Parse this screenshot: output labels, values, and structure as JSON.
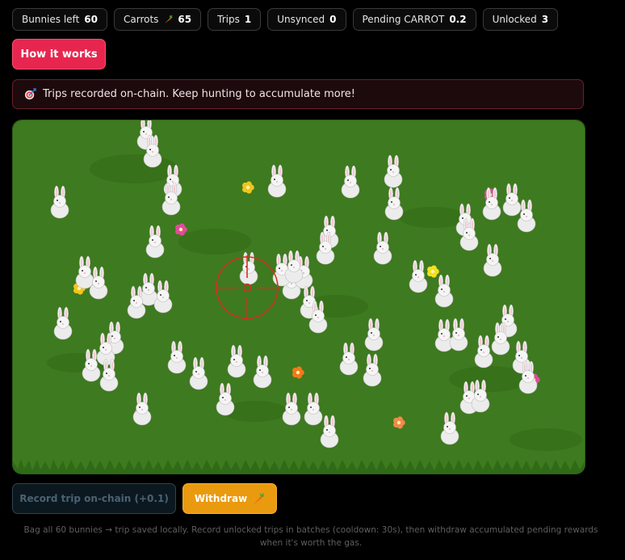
{
  "stats": [
    {
      "label": "Bunnies left",
      "value": "60"
    },
    {
      "label": "Carrots",
      "value": "65",
      "icon": "carrot-icon"
    },
    {
      "label": "Trips",
      "value": "1"
    },
    {
      "label": "Unsynced",
      "value": "0"
    },
    {
      "label": "Pending CARROT",
      "value": "0.2"
    },
    {
      "label": "Unlocked",
      "value": "3"
    }
  ],
  "how_it_works_label": "How it works",
  "notice": {
    "icon": "target-icon",
    "text": "Trips recorded on-chain. Keep hunting to accumulate more!"
  },
  "colors": {
    "grass": "#3e7a1f",
    "accent": "#e7264f",
    "withdraw": "#ea9a0f",
    "crosshair": "#d6301f"
  },
  "actions": {
    "record_label": "Record trip on-chain (+0.1)",
    "withdraw_label": "Withdraw"
  },
  "footer_text": "Bag all 60 bunnies → trip saved locally. Record unlocked trips in batches (cooldown: 30s), then withdraw accumulated pending rewards when it's worth the gas."
}
